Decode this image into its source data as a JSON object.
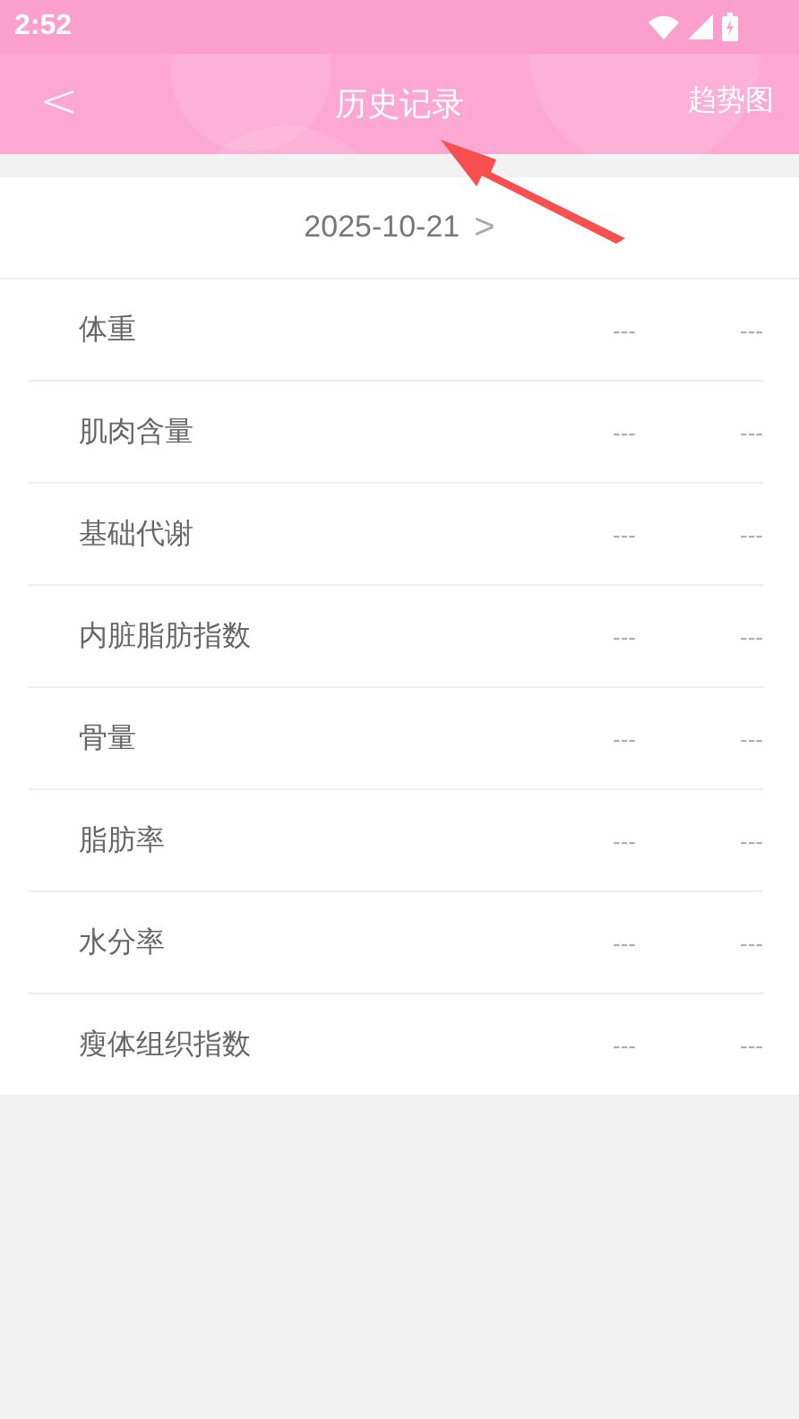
{
  "status_bar": {
    "time": "2:52"
  },
  "header": {
    "back": "<",
    "title": "历史记录",
    "action": "趋势图"
  },
  "date": {
    "value": "2025-10-21",
    "next": ">"
  },
  "metrics": [
    {
      "name": "体重",
      "value_1": "---",
      "value_2": "---"
    },
    {
      "name": "肌肉含量",
      "value_1": "---",
      "value_2": "---"
    },
    {
      "name": "基础代谢",
      "value_1": "---",
      "value_2": "---"
    },
    {
      "name": "内脏脂肪指数",
      "value_1": "---",
      "value_2": "---"
    },
    {
      "name": "骨量",
      "value_1": "---",
      "value_2": "---"
    },
    {
      "name": "脂肪率",
      "value_1": "---",
      "value_2": "---"
    },
    {
      "name": "水分率",
      "value_1": "---",
      "value_2": "---"
    },
    {
      "name": "瘦体组织指数",
      "value_1": "---",
      "value_2": "---"
    }
  ]
}
